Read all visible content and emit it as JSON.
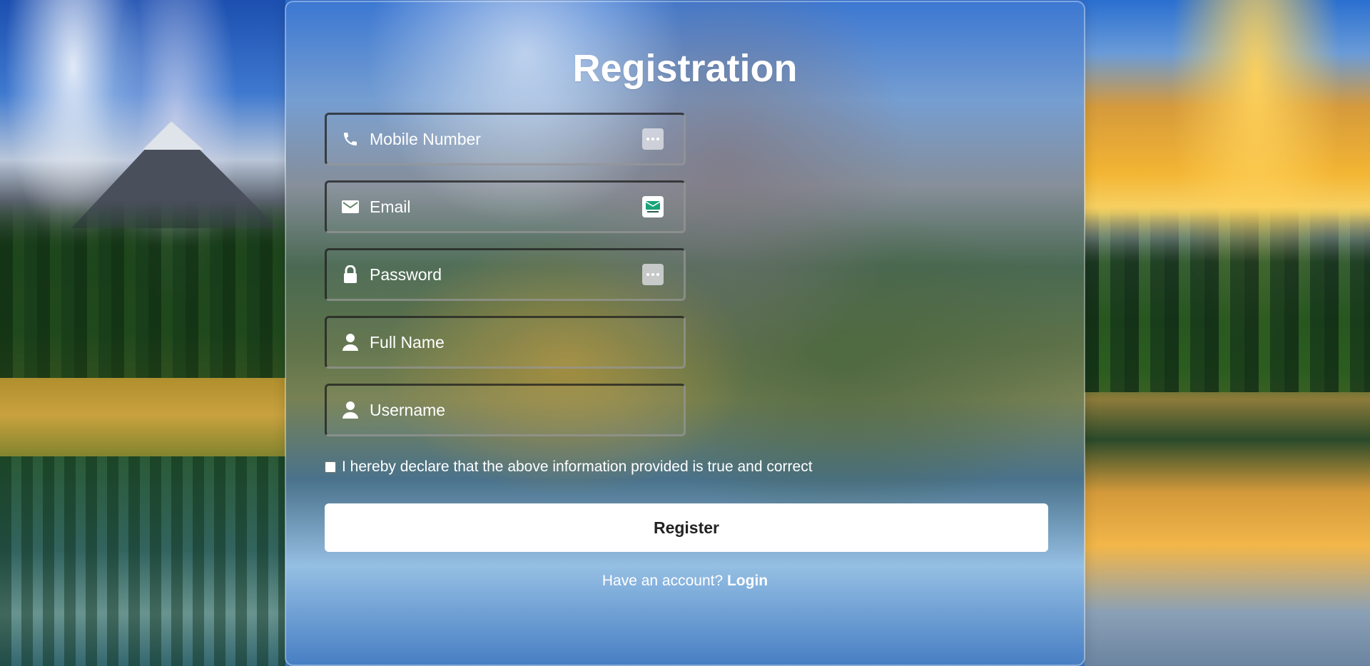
{
  "page": {
    "title": "Registration"
  },
  "form": {
    "fields": [
      {
        "key": "mobile",
        "placeholder": "Mobile Number",
        "value": "",
        "icon": "phone-icon",
        "extension_icon": "dots-autofill-icon"
      },
      {
        "key": "email",
        "placeholder": "Email",
        "value": "",
        "icon": "envelope-icon",
        "extension_icon": "tempmail-icon"
      },
      {
        "key": "password",
        "placeholder": "Password",
        "value": "",
        "icon": "lock-icon",
        "extension_icon": "dots-autofill-icon"
      },
      {
        "key": "fullname",
        "placeholder": "Full Name",
        "value": "",
        "icon": "user-icon"
      },
      {
        "key": "username",
        "placeholder": "Username",
        "value": "",
        "icon": "user-icon"
      }
    ],
    "declaration": "I hereby declare that the above information provided is true and correct",
    "declaration_checked": false,
    "submit_label": "Register",
    "account_prompt": "Have an account?",
    "login_label": "Login"
  },
  "colors": {
    "text": "#ffffff",
    "button_bg": "#ffffff",
    "button_text": "#222222",
    "tempmail_green": "#1aa37a"
  }
}
